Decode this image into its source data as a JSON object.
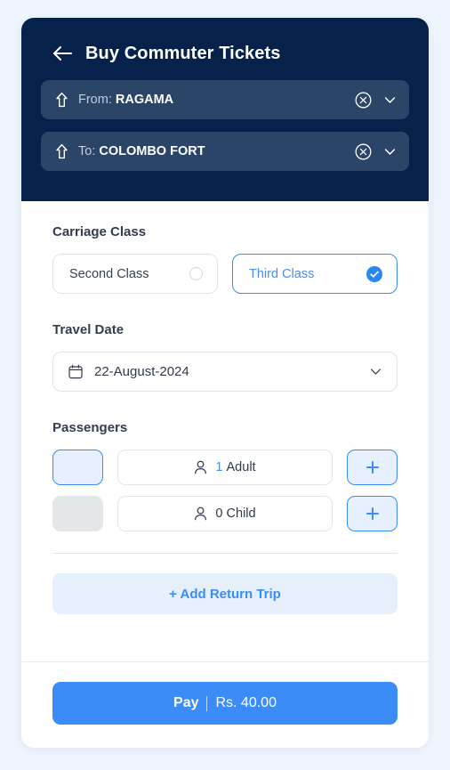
{
  "header": {
    "back_icon": "arrow-left-icon",
    "title": "Buy Commuter Tickets",
    "stations": [
      {
        "icon": "arrow-up-outline-icon",
        "label": "From:",
        "value": "RAGAMA",
        "clear_icon": "circle-x-icon",
        "chevron_icon": "chevron-down-icon"
      },
      {
        "icon": "arrow-up-outline-icon",
        "label": "To:",
        "value": "COLOMBO FORT",
        "clear_icon": "circle-x-icon",
        "chevron_icon": "chevron-down-icon"
      }
    ]
  },
  "carriage_class": {
    "label": "Carriage Class",
    "options": [
      {
        "label": "Second Class",
        "selected": false
      },
      {
        "label": "Third Class",
        "selected": true
      }
    ]
  },
  "travel_date": {
    "label": "Travel Date",
    "icon": "calendar-icon",
    "value": "22-August-2024",
    "chevron_icon": "chevron-down-icon"
  },
  "passengers": {
    "label": "Passengers",
    "rows": [
      {
        "icon": "person-icon",
        "count": "1",
        "type": "Adult",
        "decrement_label": "−",
        "increment_label": "+",
        "decrement_enabled": true
      },
      {
        "icon": "person-icon",
        "count": "0",
        "type": "Child",
        "decrement_label": "−",
        "increment_label": "+",
        "decrement_enabled": false
      }
    ]
  },
  "return_trip": {
    "label": "+ Add Return Trip"
  },
  "footer": {
    "pay_label": "Pay",
    "pay_amount": "Rs. 40.00"
  },
  "colors": {
    "page_background": "#eff5fd",
    "header_navy": "#06224b",
    "station_row": "#2b4568",
    "accent_blue": "#3b8cf7",
    "accent_blue_soft": "#e6f0fe",
    "text_dark": "#303a4c",
    "border_grey": "#dfe3ea",
    "disabled_grey": "#e4e6ea"
  }
}
